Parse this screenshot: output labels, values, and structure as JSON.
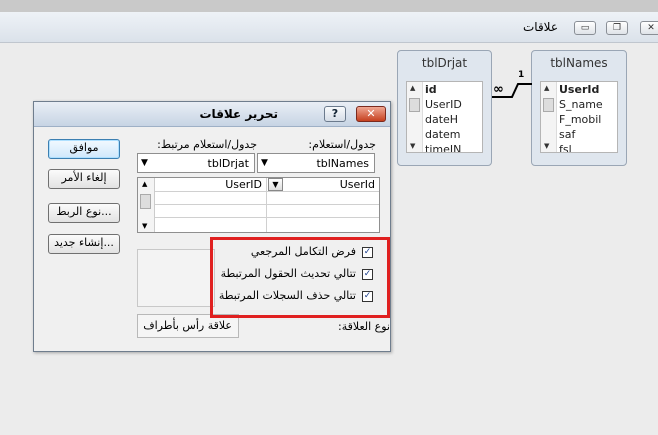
{
  "relationships_window": {
    "title": "علاقات",
    "minimize_glyph": "▭",
    "restore_glyph": "❐",
    "close_glyph": "✕"
  },
  "tables": {
    "tblDrjat": {
      "title": "tblDrjat",
      "fields": [
        "id",
        "UserID",
        "dateH",
        "datem",
        "timeIN"
      ]
    },
    "tblNames": {
      "title": "tblNames",
      "fields": [
        "UserId",
        "S_name",
        "F_mobil",
        "saf",
        "fsl"
      ]
    }
  },
  "join_line": {
    "one_label": "1",
    "many_label": "∞"
  },
  "dialog": {
    "title": "تحرير علاقات",
    "help_glyph": "?",
    "close_glyph": "✕",
    "table_query_label": "جدول/استعلام:",
    "related_table_query_label": "جدول/استعلام مرتبط:",
    "table_value": "tblNames",
    "related_table_value": "tblDrjat",
    "grid": {
      "left_field": "UserId",
      "right_field": "UserID"
    },
    "buttons": {
      "ok": "موافق",
      "cancel": "إلغاء الأمر",
      "join_type": "نوع الربط...",
      "create_new": "إنشاء جديد..."
    },
    "checkboxes": [
      {
        "label": "فرض التكامل المرجعي",
        "checked": true
      },
      {
        "label": "تتالي تحديث الحقول المرتبطة",
        "checked": true
      },
      {
        "label": "تتالي حذف السجلات المرتبطة",
        "checked": true
      }
    ],
    "relationship_type_label": "نوع العلاقة:",
    "relationship_type_value": "علاقة رأس بأطراف",
    "check_glyph": "✓"
  }
}
